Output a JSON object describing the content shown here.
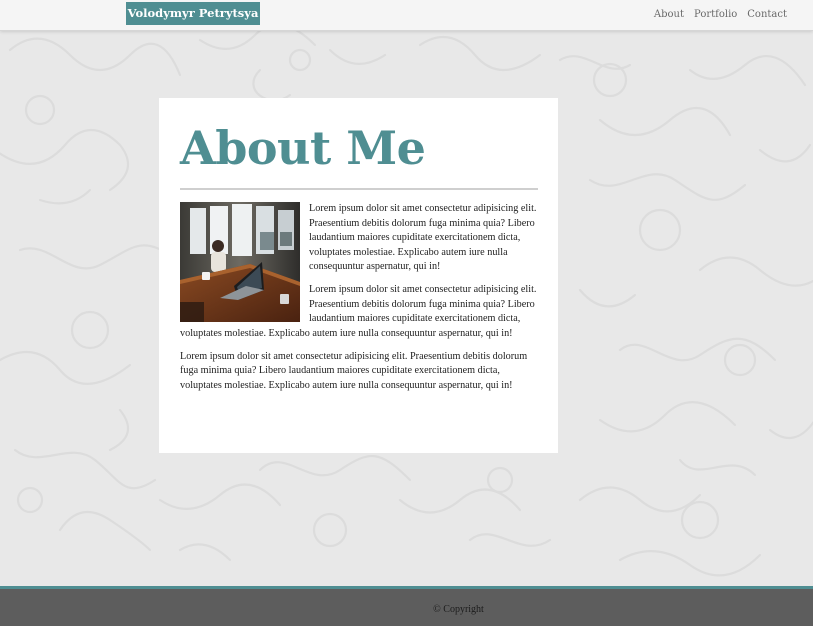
{
  "header": {
    "brand": "Volodymyr Petrytsya",
    "nav": [
      "About",
      "Portfolio",
      "Contact"
    ]
  },
  "main": {
    "title": "About Me",
    "paragraphs": [
      "Lorem ipsum dolor sit amet consectetur adipisicing elit. Praesentium debitis dolorum fuga minima quia? Libero laudantium maiores cupiditate exercitationem dicta, voluptates molestiae. Explicabo autem iure nulla consequuntur aspernatur, qui in!",
      "Lorem ipsum dolor sit amet consectetur adipisicing elit. Praesentium debitis dolorum fuga minima quia? Libero laudantium maiores cupiditate exercitationem dicta, voluptates molestiae. Explicabo autem iure nulla consequuntur aspernatur, qui in!",
      "Lorem ipsum dolor sit amet consectetur adipisicing elit. Praesentium debitis dolorum fuga minima quia? Libero laudantium maiores cupiditate exercitationem dicta, voluptates molestiae. Explicabo autem iure nulla consequuntur aspernatur, qui in!"
    ],
    "photo_icon": "cafe-laptop-photo"
  },
  "footer": {
    "copyright": "© Copyright"
  },
  "colors": {
    "accent": "#4f8e92",
    "background": "#e8e8e8",
    "footer": "#5d5d5d"
  }
}
